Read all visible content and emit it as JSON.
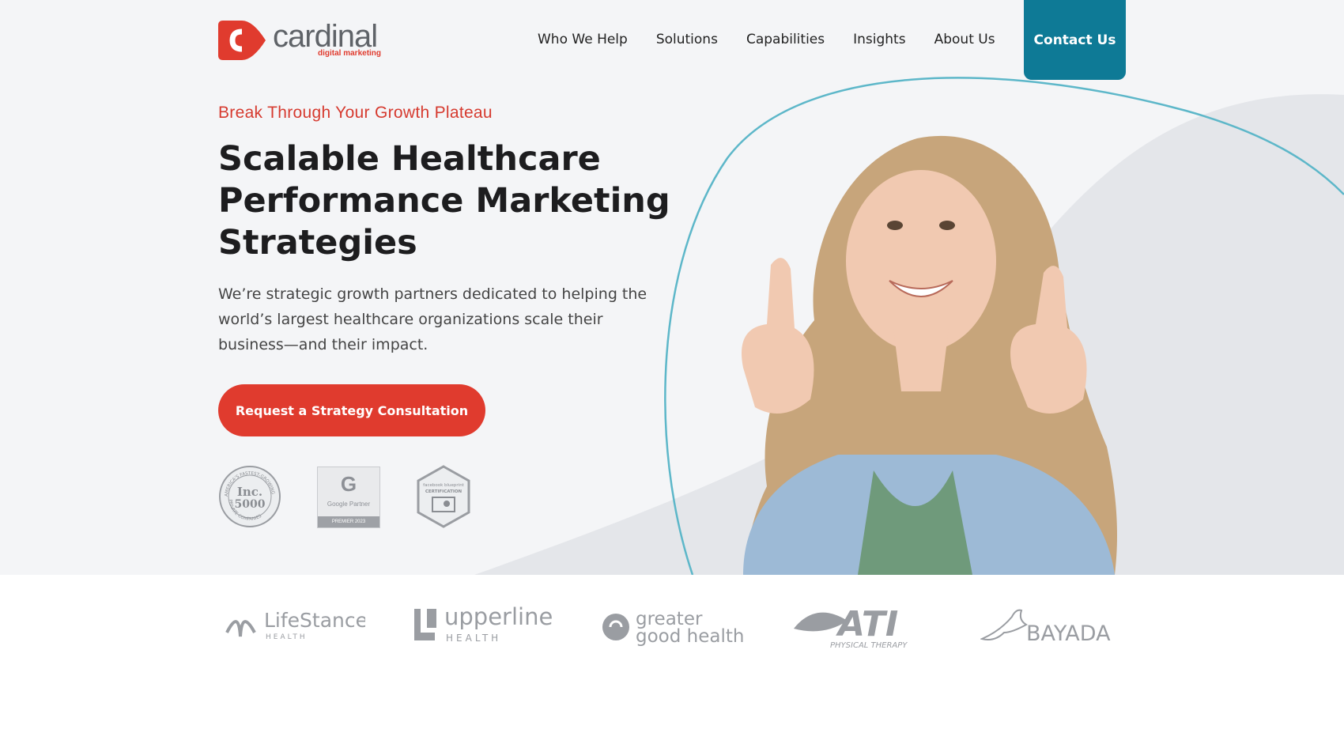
{
  "logo": {
    "word": "cardinal",
    "sub": "digital marketing"
  },
  "nav": {
    "items": [
      "Who We Help",
      "Solutions",
      "Capabilities",
      "Insights",
      "About Us"
    ],
    "contact": "Contact Us"
  },
  "hero": {
    "eyebrow": "Break Through Your Growth Plateau",
    "headline_1": "Scalable Healthcare",
    "headline_2": "Performance Marketing",
    "headline_3": "Strategies",
    "lede": "We’re strategic growth partners dedicated to helping the world’s largest healthcare organizations scale their business—and their impact.",
    "cta": "Request a Strategy Consultation"
  },
  "badges": {
    "inc_top": "AMERICA'S FASTEST-GROWING",
    "inc_main": "Inc.",
    "inc_num": "5000",
    "inc_bottom": "PRIVATE COMPANIES",
    "google_g": "G",
    "google_text": "Google Partner",
    "google_strip": "PREMIER 2023",
    "fb_line1": "facebook blueprint",
    "fb_line2": "CERTIFICATION"
  },
  "clients": {
    "lifestance": "LifeStance",
    "lifestance_sub": "HEALTH",
    "upperline": "upperline",
    "upperline_sub": "HEALTH",
    "ggh_1": "greater",
    "ggh_2": "good health",
    "ati": "ATI",
    "ati_sub": "PHYSICAL THERAPY",
    "bayada": "BAYADA"
  },
  "colors": {
    "brand_red": "#e03b2e",
    "teal": "#0e7a96",
    "hero_bg": "#f4f5f7",
    "arc": "#5db7c9"
  }
}
